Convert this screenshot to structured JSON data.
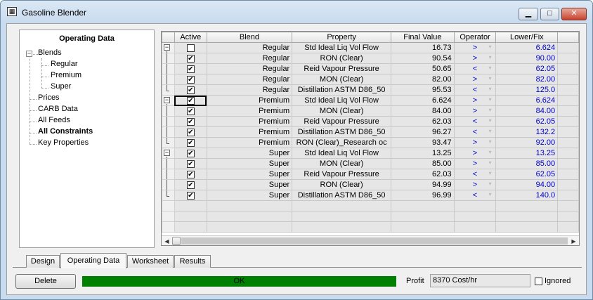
{
  "window": {
    "title": "Gasoline Blender",
    "icon": "app-grid-icon"
  },
  "tree": {
    "header": "Operating Data",
    "items": [
      {
        "label": "Blends",
        "bold": false
      },
      {
        "label": "Regular",
        "bold": false
      },
      {
        "label": "Premium",
        "bold": false
      },
      {
        "label": "Super",
        "bold": false
      },
      {
        "label": "Prices",
        "bold": false
      },
      {
        "label": "CARB Data",
        "bold": false
      },
      {
        "label": "All Feeds",
        "bold": false
      },
      {
        "label": "All Constraints",
        "bold": true
      },
      {
        "label": "Key Properties",
        "bold": false
      }
    ]
  },
  "grid": {
    "columns": [
      "Active",
      "Blend",
      "Property",
      "Final Value",
      "Operator",
      "Lower/Fix"
    ],
    "rows": [
      {
        "active": false,
        "blend": "Regular",
        "property": "Std Ideal Liq Vol Flow",
        "final": "16.73",
        "op": ">",
        "lower": "6.624"
      },
      {
        "active": true,
        "blend": "Regular",
        "property": "RON (Clear)",
        "final": "90.54",
        "op": ">",
        "lower": "90.00"
      },
      {
        "active": true,
        "blend": "Regular",
        "property": "Reid Vapour Pressure",
        "final": "50.65",
        "op": "<",
        "lower": "62.05"
      },
      {
        "active": true,
        "blend": "Regular",
        "property": "MON (Clear)",
        "final": "82.00",
        "op": ">",
        "lower": "82.00"
      },
      {
        "active": true,
        "blend": "Regular",
        "property": "Distillation ASTM D86_50",
        "final": "95.53",
        "op": "<",
        "lower": "125.0"
      },
      {
        "active": true,
        "blend": "Premium",
        "property": "Std Ideal Liq Vol Flow",
        "final": "6.624",
        "op": ">",
        "lower": "6.624"
      },
      {
        "active": true,
        "blend": "Premium",
        "property": "MON (Clear)",
        "final": "84.00",
        "op": ">",
        "lower": "84.00"
      },
      {
        "active": true,
        "blend": "Premium",
        "property": "Reid Vapour Pressure",
        "final": "62.03",
        "op": "<",
        "lower": "62.05"
      },
      {
        "active": true,
        "blend": "Premium",
        "property": "Distillation ASTM D86_50",
        "final": "96.27",
        "op": "<",
        "lower": "132.2"
      },
      {
        "active": true,
        "blend": "Premium",
        "property": "RON (Clear)_Research oc",
        "final": "93.47",
        "op": ">",
        "lower": "92.00"
      },
      {
        "active": true,
        "blend": "Super",
        "property": "Std Ideal Liq Vol Flow",
        "final": "13.25",
        "op": ">",
        "lower": "13.25"
      },
      {
        "active": true,
        "blend": "Super",
        "property": "MON (Clear)",
        "final": "85.00",
        "op": ">",
        "lower": "85.00"
      },
      {
        "active": true,
        "blend": "Super",
        "property": "Reid Vapour Pressure",
        "final": "62.03",
        "op": "<",
        "lower": "62.05"
      },
      {
        "active": true,
        "blend": "Super",
        "property": "RON (Clear)",
        "final": "94.99",
        "op": ">",
        "lower": "94.00"
      },
      {
        "active": true,
        "blend": "Super",
        "property": "Distillation ASTM D86_50",
        "final": "96.99",
        "op": "<",
        "lower": "140.0"
      }
    ]
  },
  "tabs": [
    "Design",
    "Operating Data",
    "Worksheet",
    "Results"
  ],
  "active_tab": "Operating Data",
  "footer": {
    "delete_label": "Delete",
    "status": "OK",
    "status_color": "#008000",
    "profit_label": "Profit",
    "profit_value": "8370 Cost/hr",
    "ignored_label": "Ignored"
  },
  "colors": {
    "value_blue": "#0000cc",
    "status_green": "#008000"
  }
}
